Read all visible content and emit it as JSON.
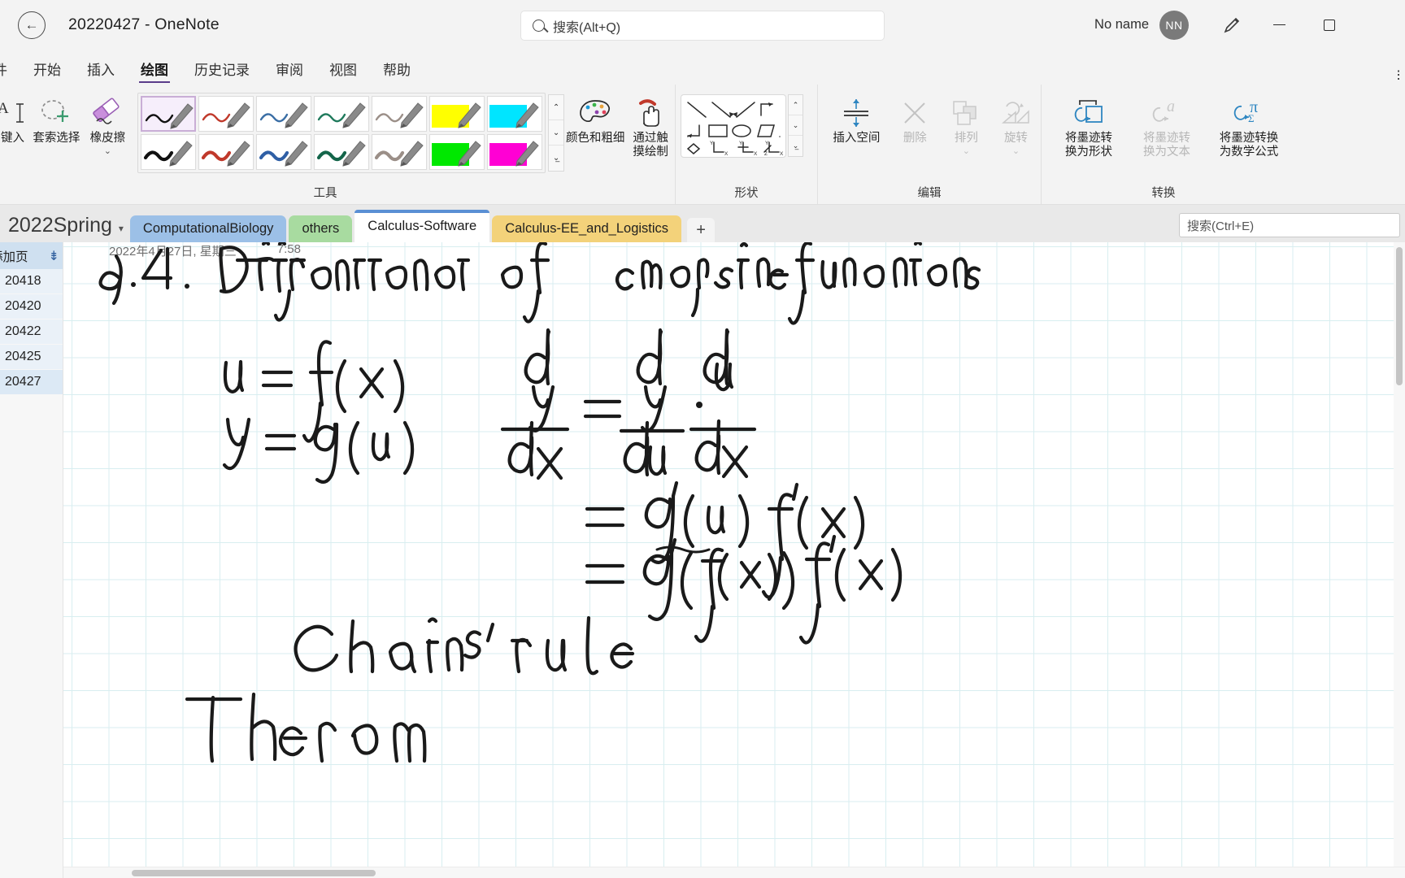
{
  "titlebar": {
    "back_icon": "back-arrow-icon",
    "title": "20220427  -  OneNote",
    "search_placeholder": "搜索(Alt+Q)",
    "account_name": "No name",
    "avatar_initials": "NN",
    "pen_icon": "pen-icon",
    "minimize": "—",
    "maximize": "▢",
    "close": "✕"
  },
  "ribbon_tabs": {
    "items": [
      {
        "label": "件",
        "active": false
      },
      {
        "label": "开始",
        "active": false
      },
      {
        "label": "插入",
        "active": false
      },
      {
        "label": "绘图",
        "active": true
      },
      {
        "label": "历史记录",
        "active": false
      },
      {
        "label": "审阅",
        "active": false
      },
      {
        "label": "视图",
        "active": false
      },
      {
        "label": "帮助",
        "active": false
      }
    ],
    "right_overflow": "⫶"
  },
  "ribbon": {
    "groups": [
      {
        "name": "tools",
        "label": "工具"
      },
      {
        "name": "shapes",
        "label": "形状"
      },
      {
        "name": "edit",
        "label": "编辑"
      },
      {
        "name": "convert",
        "label": "转换"
      }
    ],
    "tools": {
      "type_button": {
        "label_line1": "键入",
        "icon": "text-cursor-icon"
      },
      "lasso_button": {
        "label": "套索选择",
        "icon": "lasso-select-icon"
      },
      "eraser_button": {
        "label": "橡皮擦",
        "icon": "eraser-icon",
        "chevron": "⌄"
      },
      "pens": [
        {
          "name": "pen-black-thin",
          "color": "#111111",
          "width": 2.4,
          "type": "pen",
          "selected": true
        },
        {
          "name": "pen-red-thin",
          "color": "#c0392b",
          "width": 2.4,
          "type": "pen",
          "selected": false
        },
        {
          "name": "pen-blue-thin",
          "color": "#3a6ea5",
          "width": 2.4,
          "type": "pen",
          "selected": false
        },
        {
          "name": "pen-green-thin",
          "color": "#1f7a5c",
          "width": 2.4,
          "type": "pen",
          "selected": false
        },
        {
          "name": "pen-gray-thin",
          "color": "#9b8f88",
          "width": 2.4,
          "type": "pen",
          "selected": false
        },
        {
          "name": "highlighter-yellow",
          "color": "#ffff00",
          "width": 0,
          "type": "highlighter",
          "selected": false
        },
        {
          "name": "highlighter-cyan",
          "color": "#00e5ff",
          "width": 0,
          "type": "highlighter",
          "selected": false
        },
        {
          "name": "pen-black-thick",
          "color": "#111111",
          "width": 4.2,
          "type": "pen",
          "selected": false
        },
        {
          "name": "pen-red-thick",
          "color": "#c0392b",
          "width": 4.2,
          "type": "pen",
          "selected": false
        },
        {
          "name": "pen-blue-thick",
          "color": "#2f5fa5",
          "width": 4.2,
          "type": "pen",
          "selected": false
        },
        {
          "name": "pen-green-thick",
          "color": "#14654a",
          "width": 4.2,
          "type": "pen",
          "selected": false
        },
        {
          "name": "pen-gray-thick",
          "color": "#9b8f88",
          "width": 4.2,
          "type": "pen",
          "selected": false
        },
        {
          "name": "highlighter-green",
          "color": "#00e800",
          "width": 0,
          "type": "highlighter",
          "selected": false
        },
        {
          "name": "highlighter-magenta",
          "color": "#ff00d4",
          "width": 0,
          "type": "highlighter",
          "selected": false
        }
      ],
      "pen_scroll": {
        "up": "⌃",
        "down": "⌄",
        "more": "⌄̲"
      },
      "color_thickness": {
        "label_line1": "颜色和粗细",
        "icon": "palette-icon"
      },
      "draw_with_touch": {
        "label_line1": "通过触",
        "label_line2": "摸绘制",
        "icon": "touch-hand-icon"
      }
    },
    "shapes": {
      "gallery_icons": [
        "line-icon",
        "arrow-icon",
        "arrow-up-right-icon",
        "elbow-arrow-icon",
        "elbow-arrow-down-icon",
        "elbow-left-down-icon",
        "rectangle-icon",
        "ellipse-icon",
        "parallelogram-icon",
        "triangle-icon",
        "diamond-icon",
        "axis-xy-icon",
        "axis-3-icon",
        "axis-3d-icon"
      ],
      "scroll": {
        "up": "⌃",
        "down": "⌄",
        "more": "⌄̲"
      }
    },
    "edit": {
      "insert_space": {
        "label": "插入空间",
        "icon": "insert-space-icon",
        "disabled": false
      },
      "delete": {
        "label": "删除",
        "icon": "delete-x-icon",
        "disabled": true
      },
      "arrange": {
        "label": "排列",
        "icon": "arrange-icon",
        "disabled": true,
        "chevron": "⌄"
      },
      "rotate": {
        "label": "旋转",
        "icon": "rotate-icon",
        "disabled": true,
        "chevron": "⌄"
      }
    },
    "convert": {
      "ink_to_shape": {
        "label_line1": "将墨迹转",
        "label_line2": "换为形状",
        "icon": "ink-to-shape-icon",
        "disabled": false
      },
      "ink_to_text": {
        "label_line1": "将墨迹转",
        "label_line2": "换为文本",
        "icon": "ink-to-text-icon",
        "disabled": true
      },
      "ink_to_math": {
        "label_line1": "将墨迹转换",
        "label_line2": "为数学公式",
        "icon": "ink-to-math-icon",
        "disabled": false
      }
    }
  },
  "section_bar": {
    "notebook_name": "2022Spring",
    "notebook_caret": "▾",
    "sections": [
      {
        "label": "ComputationalBiology",
        "color": "#9cc0e7",
        "active": false
      },
      {
        "label": "others",
        "color": "#a8dba0",
        "active": false
      },
      {
        "label": "Calculus-Software",
        "color": "#8fb8e0",
        "active": true
      },
      {
        "label": "Calculus-EE_and_Logistics",
        "color": "#f3d27a",
        "active": false
      }
    ],
    "add_section": "+",
    "search_placeholder": "搜索(Ctrl+E)",
    "search_icon": "search-icon"
  },
  "page_list": {
    "add_page_label": "添加页",
    "sort_icon": "sort-icon",
    "pages": [
      {
        "label": "20418",
        "active": false
      },
      {
        "label": "20420",
        "active": false
      },
      {
        "label": "20422",
        "active": false
      },
      {
        "label": "20425",
        "active": false
      },
      {
        "label": "20427",
        "active": true
      }
    ]
  },
  "canvas": {
    "page_date": "2022年4月27日, 星期三",
    "page_time": "7:58",
    "ink_note": {
      "heading": "9.4.   Differentiation of composite functions",
      "lines": [
        "u = f(x)",
        "y = g(u)",
        "dy/dx = dy/du · du/dx",
        "= g'(u) f'(x)",
        "= g'(f(x)) f'(x)",
        "Chain's rule",
        "Theorem"
      ],
      "ink_color": "#1a1a1a"
    }
  }
}
